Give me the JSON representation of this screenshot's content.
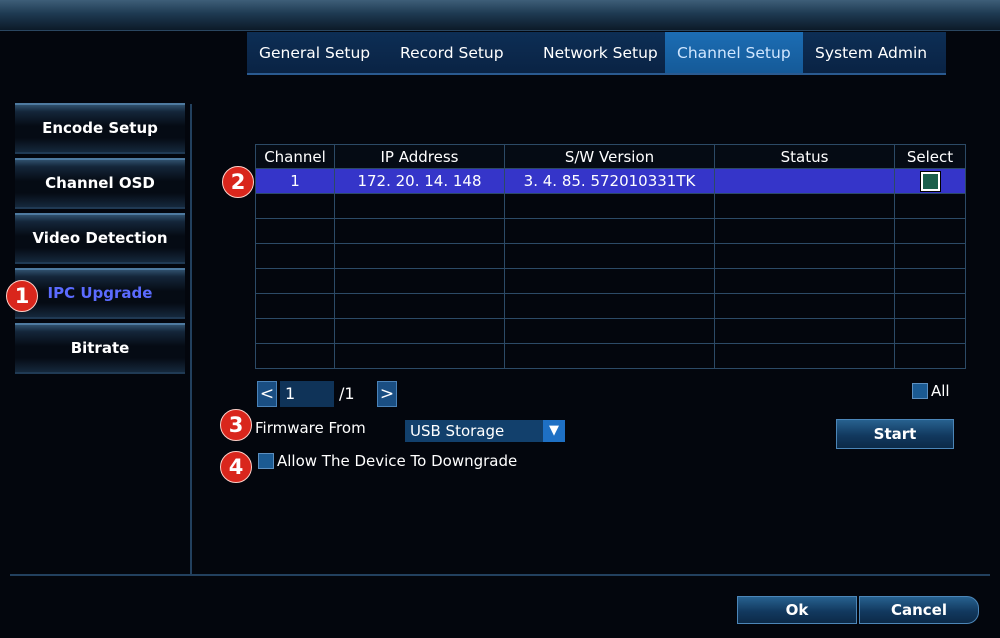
{
  "tabs": [
    {
      "label": "General Setup"
    },
    {
      "label": "Record Setup"
    },
    {
      "label": "Network Setup"
    },
    {
      "label": "Channel Setup",
      "active": true
    },
    {
      "label": "System Admin"
    }
  ],
  "sidebar": {
    "items": [
      {
        "label": "Encode Setup"
      },
      {
        "label": "Channel OSD"
      },
      {
        "label": "Video Detection"
      },
      {
        "label": "IPC Upgrade",
        "active": true
      },
      {
        "label": "Bitrate"
      }
    ]
  },
  "badges": [
    "1",
    "2",
    "3",
    "4"
  ],
  "table": {
    "headers": [
      "Channel",
      "IP Address",
      "S/W Version",
      "Status",
      "Select"
    ],
    "rows": [
      {
        "channel": "1",
        "ip": "172. 20. 14. 148",
        "version": "3. 4. 85. 572010331TK",
        "status": "",
        "selected": true
      }
    ]
  },
  "pager": {
    "prev_icon": "chevron-left-icon",
    "next_icon": "chevron-right-icon",
    "prev": "<",
    "next": ">",
    "current": "1",
    "total": "/1"
  },
  "select_all_label": "All",
  "firmware": {
    "label": "Firmware From",
    "value": "USB Storage",
    "arrow": "▼"
  },
  "start_label": "Start",
  "downgrade_label": "Allow The Device To Downgrade",
  "footer": {
    "ok_label": "Ok",
    "cancel_label": "Cancel"
  },
  "colors": {
    "accent": "#1c6db4",
    "selected_row": "#3535c9",
    "badge": "#d9261c",
    "active_sidebar_text": "#5b6bff"
  }
}
